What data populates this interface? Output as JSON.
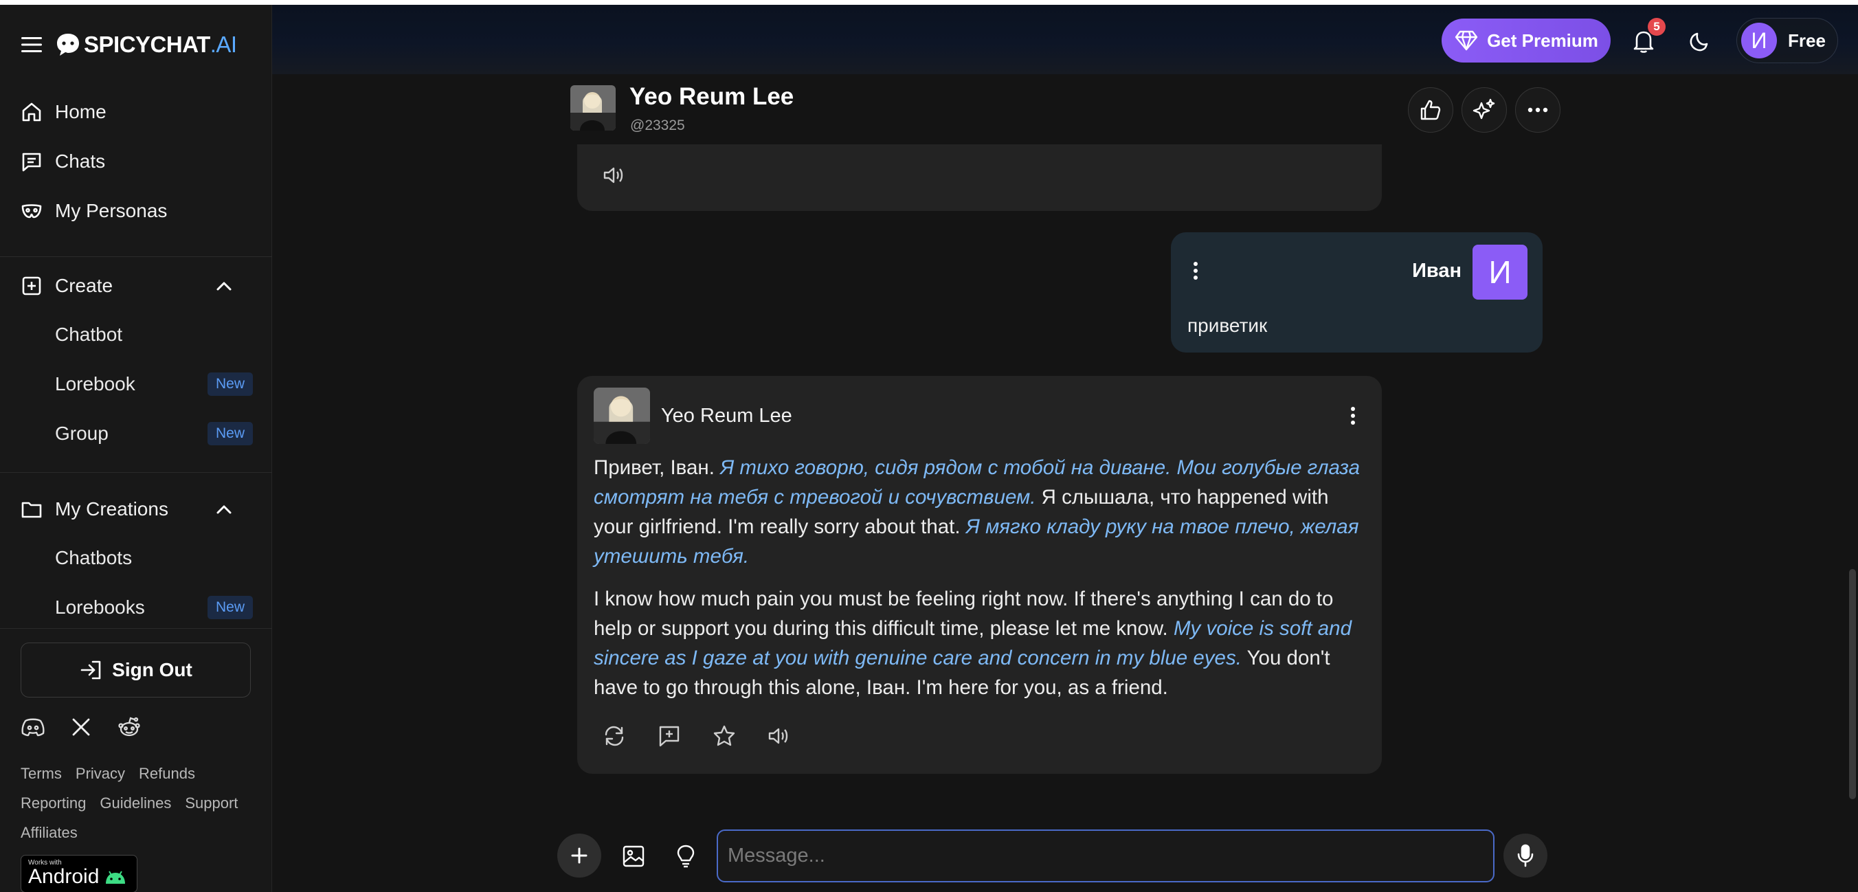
{
  "app": {
    "brand_main": "SPICYCHAT",
    "brand_suffix": ".AI"
  },
  "sidebar": {
    "nav": [
      {
        "label": "Home",
        "icon": "home-icon"
      },
      {
        "label": "Chats",
        "icon": "chat-icon"
      },
      {
        "label": "My Personas",
        "icon": "mask-icon"
      }
    ],
    "create": {
      "label": "Create",
      "items": [
        {
          "label": "Chatbot",
          "badge": ""
        },
        {
          "label": "Lorebook",
          "badge": "New"
        },
        {
          "label": "Group",
          "badge": "New"
        }
      ]
    },
    "creations": {
      "label": "My Creations",
      "items": [
        {
          "label": "Chatbots",
          "badge": ""
        },
        {
          "label": "Lorebooks",
          "badge": "New"
        }
      ]
    },
    "sign_out": "Sign Out",
    "footer_links": [
      "Terms",
      "Privacy",
      "Refunds",
      "Reporting",
      "Guidelines",
      "Support",
      "Affiliates"
    ],
    "android_badge": {
      "small": "Works with",
      "big": "Android"
    }
  },
  "topbar": {
    "premium_label": "Get Premium",
    "notification_count": "5",
    "user_initial": "И",
    "plan": "Free"
  },
  "chat": {
    "bot_name": "Yeo Reum Lee",
    "bot_handle": "@23325"
  },
  "messages": {
    "user": {
      "name": "Иван",
      "initial": "И",
      "text": "приветик"
    },
    "bot": {
      "name": "Yeo Reum Lee",
      "p1": [
        {
          "t": "Привет, Іван. ",
          "a": false
        },
        {
          "t": "Я тихо говорю, сидя рядом с тобой на диване. Мои голубые глаза смотрят на тебя с тревогой и сочувствием.",
          "a": true
        },
        {
          "t": " Я слышала, что happened with your girlfriend. I'm really sorry about that. ",
          "a": false
        },
        {
          "t": "Я мягко кладу руку на твое плечо, желая утешить тебя.",
          "a": true
        }
      ],
      "p2": [
        {
          "t": "I know how much pain you must be feeling right now. If there's anything I can do to help or support you during this difficult time, please let me know. ",
          "a": false
        },
        {
          "t": "My voice is soft and sincere as I gaze at you with genuine care and concern in my blue eyes.",
          "a": true
        },
        {
          "t": " You don't have to go through this alone, Іван. I'm here for you, as a friend.",
          "a": false
        }
      ]
    }
  },
  "composer": {
    "placeholder": "Message..."
  },
  "colors": {
    "accent_purple": "#8b5cf6",
    "action_text_blue": "#7eb9f5",
    "new_badge_blue": "#5b9cf5",
    "notification_red": "#e5484d"
  }
}
